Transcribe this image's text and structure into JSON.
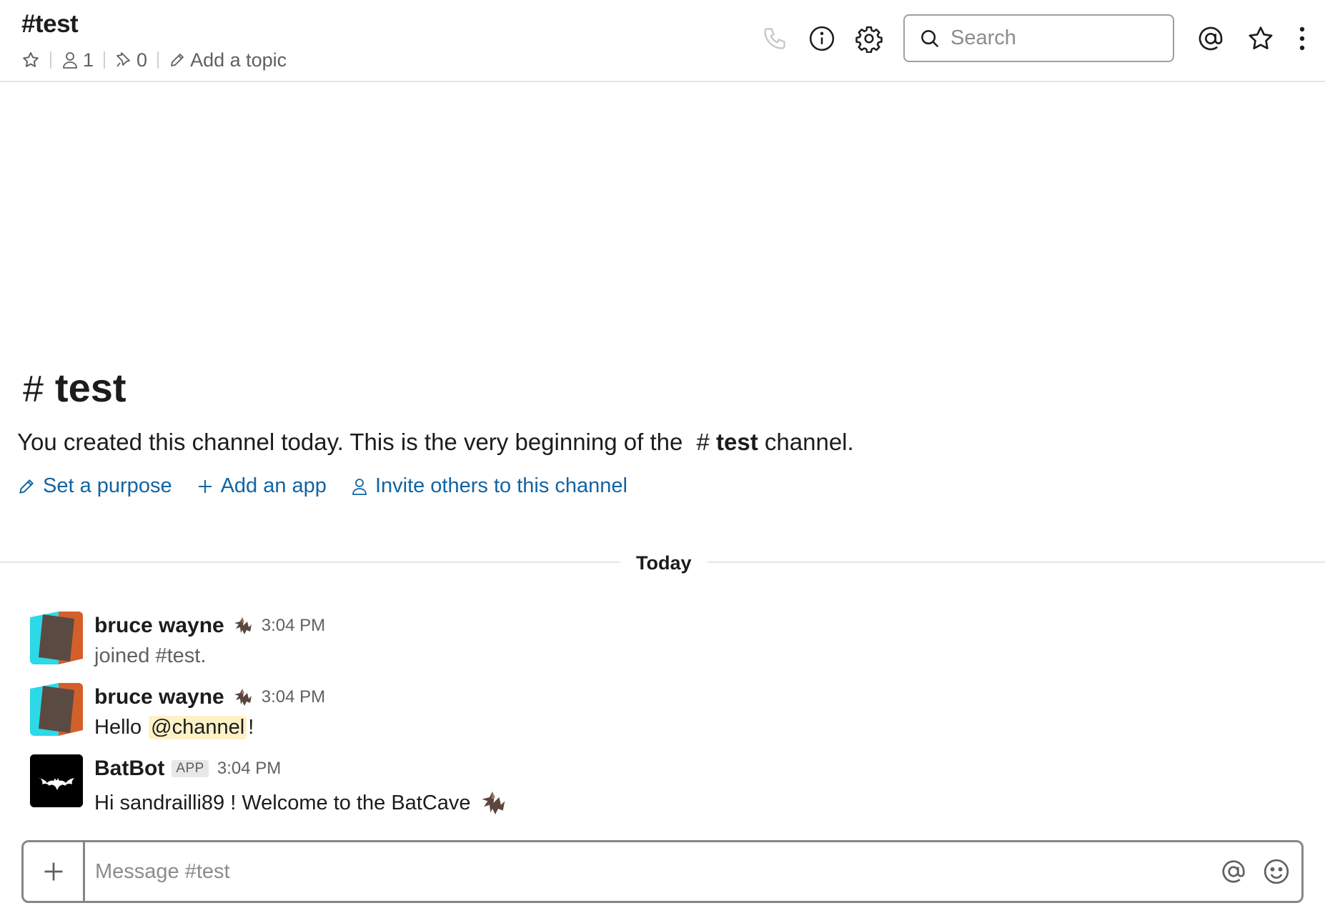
{
  "header": {
    "title": "#test",
    "member_count": "1",
    "pinned_count": "0",
    "topic_placeholder": "Add a topic",
    "search_placeholder": "Search"
  },
  "intro": {
    "hash": "#",
    "title": "test",
    "text": "You created this channel today. This is the very beginning of the",
    "channel_ref": "test",
    "text_suffix": "channel.",
    "actions": [
      {
        "label": "Set a purpose",
        "icon": "pencil-icon"
      },
      {
        "label": "Add an app",
        "icon": "plus-icon"
      },
      {
        "label": "Invite others to this channel",
        "icon": "person-icon"
      }
    ]
  },
  "divider": {
    "label": "Today"
  },
  "messages": [
    {
      "sender": "bruce wayne",
      "time": "3:04 PM",
      "text": "joined #test."
    },
    {
      "sender": "bruce wayne",
      "time": "3:04 PM",
      "prefix": "Hello",
      "mention": "@channel",
      "suffix": "!"
    },
    {
      "sender": "BatBot",
      "badge": "APP",
      "time": "3:04 PM",
      "text": "Hi sandrailli89 ! Welcome to the BatCave"
    }
  ],
  "composer": {
    "placeholder": "Message #test"
  },
  "colors": {
    "link": "#1264a3",
    "mention_bg": "#fdf1c7",
    "avatar_orange": "#d35f2b",
    "avatar_cyan": "#2bd9e8",
    "avatar_brown": "#5a4a42"
  }
}
